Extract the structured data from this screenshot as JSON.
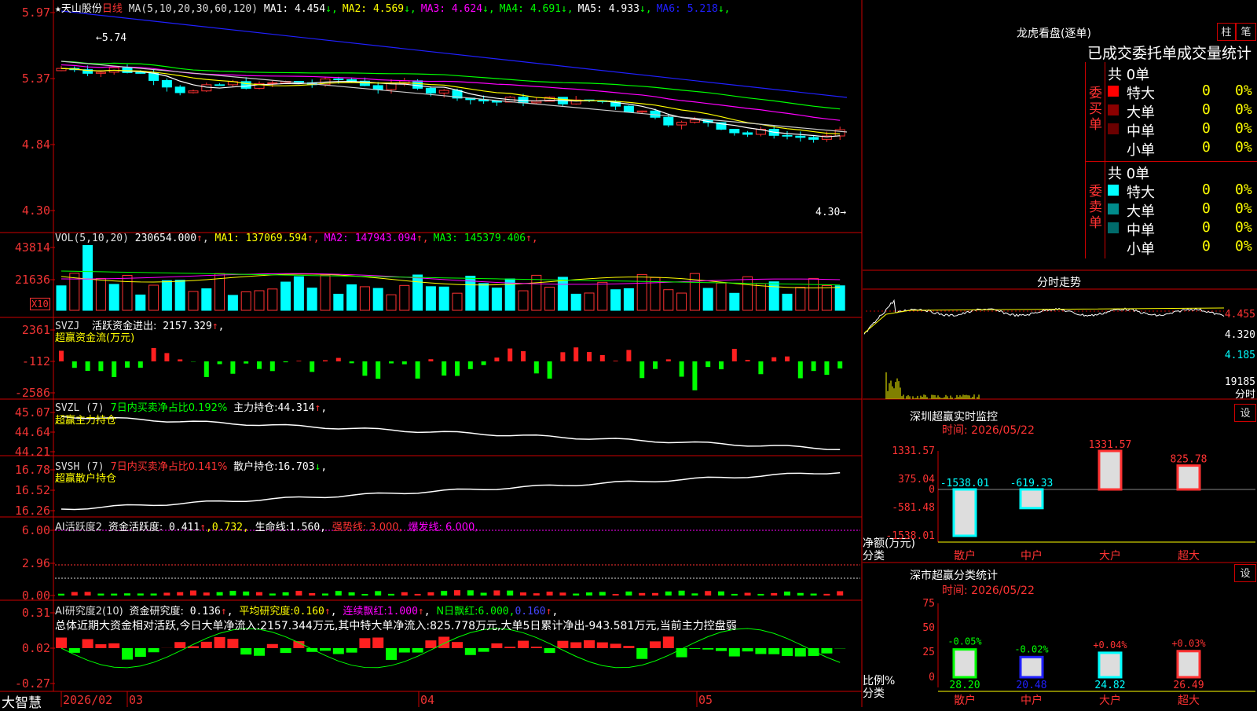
{
  "stock": {
    "star": "★",
    "name": "天山股份",
    "period": "日线"
  },
  "kline": {
    "ma_params": "MA(5,10,20,30,60,120)",
    "ma": [
      {
        "label": "MA1:",
        "value": "4.454",
        "arrow": "↓",
        "color": "#ffffff"
      },
      {
        "label": "MA2:",
        "value": "4.569",
        "arrow": "↓",
        "color": "#ffff00"
      },
      {
        "label": "MA3:",
        "value": "4.624",
        "arrow": "↓",
        "color": "#ff00ff"
      },
      {
        "label": "MA4:",
        "value": "4.691",
        "arrow": "↓",
        "color": "#00ff00"
      },
      {
        "label": "MA5:",
        "value": "4.933",
        "arrow": "↓",
        "color": "#ffffff"
      },
      {
        "label": "MA6:",
        "value": "5.218",
        "arrow": "↓",
        "color": "#2020ff"
      }
    ],
    "y_labels": [
      "5.97",
      "5.37",
      "4.84",
      "4.30"
    ],
    "high_note": "5.74",
    "low_note": "4.30"
  },
  "vol": {
    "label": "VOL(5,10,20)",
    "value": "230654.000",
    "arrow": "↑",
    "ma": [
      {
        "label": "MA1:",
        "value": "137069.594",
        "arrow": "↑",
        "color": "#ffff00"
      },
      {
        "label": "MA2:",
        "value": "147943.094",
        "arrow": "↑",
        "color": "#ff00ff"
      },
      {
        "label": "MA3:",
        "value": "145379.406",
        "arrow": "↑",
        "color": "#00ff00"
      }
    ],
    "y_labels": [
      "43814",
      "21636"
    ],
    "unit": "X10"
  },
  "svzj": {
    "label": "SVZJ",
    "text1": "活跃资金进出:",
    "value": "2157.329",
    "arrow": "↑",
    "sep": ",",
    "text2": "超赢资金流(万元)",
    "y_labels": [
      "2361",
      "-112",
      "-2586"
    ]
  },
  "svzl": {
    "label": "SVZL (7)",
    "text1": "7日内买卖净占比0.192%",
    "text2": "主力持仓:",
    "value": "44.314",
    "arrow": "↑",
    "sep": ",",
    "text3": "超赢主力持仓",
    "y_labels": [
      "45.07",
      "44.64",
      "44.21"
    ]
  },
  "svsh": {
    "label": "SVSH (7)",
    "text1": "7日内买卖净占比0.141%",
    "text2": "散户持仓:",
    "value": "16.703",
    "arrow": "↓",
    "sep": ",",
    "text3": "超赢散户持仓",
    "y_labels": [
      "16.78",
      "16.52",
      "16.26"
    ]
  },
  "ai_active": {
    "label": "AI活跃度2",
    "text1": "资金活跃度:",
    "v1": "0.411",
    "a1": "↑",
    "v2": ",0.732,",
    "text2": "生命线:",
    "v3": "1.560,",
    "strong": "强势线: 3.000,",
    "burst": "爆发线: 6.000,",
    "y_labels": [
      "6.00",
      "2.96",
      "0.00"
    ]
  },
  "ai_research": {
    "label": "AI研究度2(10)",
    "text1": "资金研究度:",
    "v1": "0.136",
    "a1": "↑",
    "sep1": ",",
    "text2": "平均研究度:",
    "v2": "0.160",
    "a2": "↑",
    "sep2": ",",
    "text3": "连续飘红:",
    "v3": "1.000",
    "a3": "↑",
    "sep3": ",",
    "text4": "N日飘红:",
    "v4": "6.000,",
    "v5": "0.160",
    "a5": "↑",
    "sep5": ",",
    "summary": "总体近期大资金相对活跃,今日大单净流入:2157.344万元,其中特大单净流入:825.778万元,大单5日累计净出-943.581万元,当前主力控盘弱",
    "y_labels": [
      "0.31",
      "0.02",
      "-0.27"
    ]
  },
  "date_axis": {
    "brand": "大智慧",
    "labels": [
      "2026/02",
      "03",
      "04",
      "05"
    ]
  },
  "dragon": {
    "title": "龙虎看盘(逐单)",
    "btn1": "柱",
    "btn2": "笔",
    "header": "已成交委托单成交量统计",
    "buy": {
      "side": "委买单",
      "total": "共 0单",
      "rows": [
        {
          "name": "特大",
          "count": "0",
          "pct": "0%",
          "color": "#ff0000"
        },
        {
          "name": "大单",
          "count": "0",
          "pct": "0%",
          "color": "#8b0000"
        },
        {
          "name": "中单",
          "count": "0",
          "pct": "0%",
          "color": "#6b0000"
        },
        {
          "name": "小单",
          "count": "0",
          "pct": "0%",
          "color": "#000000"
        }
      ]
    },
    "sell": {
      "side": "委卖单",
      "total": "共 0单",
      "rows": [
        {
          "name": "特大",
          "count": "0",
          "pct": "0%",
          "color": "#00ffff"
        },
        {
          "name": "大单",
          "count": "0",
          "pct": "0%",
          "color": "#008b8b"
        },
        {
          "name": "中单",
          "count": "0",
          "pct": "0%",
          "color": "#006b6b"
        },
        {
          "name": "小单",
          "count": "0",
          "pct": "0%",
          "color": "#000000"
        }
      ]
    }
  },
  "intraday": {
    "title": "分时走势",
    "prices": [
      "4.455",
      "4.320",
      "4.185"
    ],
    "vol": "19185",
    "vol_unit": "分时"
  },
  "monitor": {
    "title": "深圳超赢实时监控",
    "set_btn": "设",
    "time": "时间: 2026/05/22",
    "y_labels": [
      "1331.57",
      "375.04",
      "0",
      "-581.48",
      "-1538.01"
    ],
    "ylabel": "净额(万元)",
    "xlabel": "分类",
    "chart_data": {
      "type": "bar",
      "categories": [
        "散户",
        "中户",
        "大户",
        "超大"
      ],
      "values": [
        -1538.01,
        -619.33,
        1331.57,
        825.78
      ],
      "value_labels": [
        "-1538.01",
        "-619.33",
        "1331.57",
        "825.78"
      ],
      "ylim": [
        -1538.01,
        1331.57
      ]
    }
  },
  "classify": {
    "title": "深市超赢分类统计",
    "set_btn": "设",
    "time": "时间: 2026/05/22",
    "y_labels": [
      "75",
      "50",
      "25",
      "0"
    ],
    "ylabel": "比例%",
    "xlabel": "分类",
    "chart_data": {
      "type": "bar",
      "categories": [
        "散户",
        "中户",
        "大户",
        "超大"
      ],
      "values": [
        28.2,
        20.48,
        24.82,
        26.49
      ],
      "changes": [
        "-0.05%",
        "-0.02%",
        "+0.04%",
        "+0.03%"
      ],
      "value_labels": [
        "28.20",
        "20.48",
        "24.82",
        "26.49"
      ],
      "ylim": [
        0,
        75
      ]
    }
  }
}
